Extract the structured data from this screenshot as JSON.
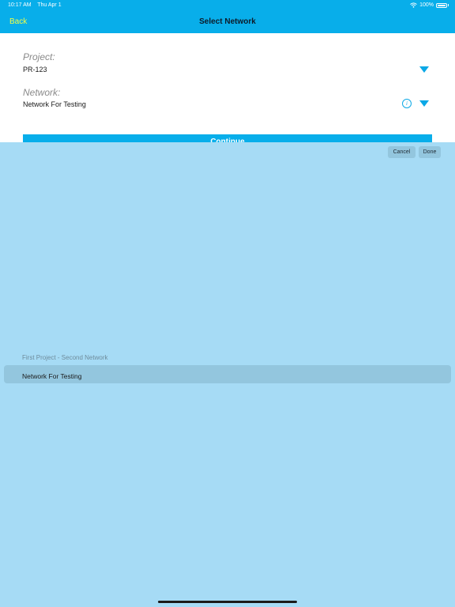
{
  "status": {
    "time": "10:17 AM",
    "date": "Thu Apr 1",
    "battery": "100%"
  },
  "nav": {
    "back_label": "Back",
    "title": "Select Network"
  },
  "form": {
    "project_label": "Project:",
    "project_value": "PR-123",
    "network_label": "Network:",
    "network_value": "Network For Testing",
    "info_glyph": "i",
    "continue_label": "Continue"
  },
  "picker": {
    "cancel_label": "Cancel",
    "done_label": "Done",
    "options": [
      {
        "label": "First Project - Second Network",
        "selected": false
      },
      {
        "label": "Network For Testing",
        "selected": true
      }
    ]
  },
  "colors": {
    "accent": "#08aeea",
    "back_link": "#f3ff45",
    "picker_bg": "#a6dbf5"
  },
  "icons": [
    "wifi-icon",
    "battery-icon",
    "dropdown-caret-icon",
    "info-icon"
  ]
}
